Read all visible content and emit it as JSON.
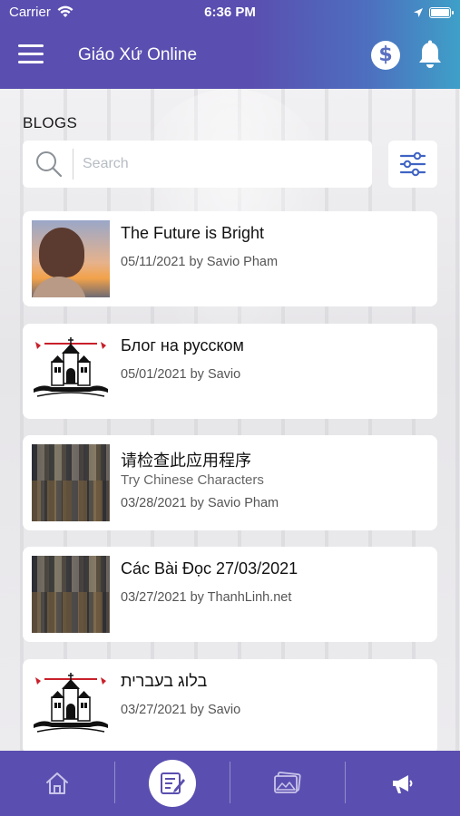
{
  "status_bar": {
    "carrier": "Carrier",
    "time": "6:36 PM"
  },
  "header": {
    "title": "Giáo Xứ Online"
  },
  "page": {
    "section_title": "BLOGS"
  },
  "search": {
    "placeholder": "Search"
  },
  "posts": [
    {
      "title": "The Future is Bright",
      "subtitle": "",
      "meta": "05/11/2021 by Savio Pham",
      "thumbnail": "sunset-portrait"
    },
    {
      "title": "Блог на русском",
      "subtitle": "",
      "meta": "05/01/2021 by Savio",
      "thumbnail": "church-logo"
    },
    {
      "title": "请检查此应用程序",
      "subtitle": "Try Chinese Characters",
      "meta": "03/28/2021 by Savio Pham",
      "thumbnail": "crowd-photo"
    },
    {
      "title": "Các Bài Đọc 27/03/2021",
      "subtitle": "",
      "meta": "03/27/2021 by ThanhLinh.net",
      "thumbnail": "crowd-photo"
    },
    {
      "title": "בלוג בעברית",
      "subtitle": "",
      "meta": "03/27/2021 by Savio",
      "thumbnail": "church-logo"
    }
  ],
  "tabbar": {
    "items": [
      {
        "icon": "home-icon",
        "active": false
      },
      {
        "icon": "blog-edit-icon",
        "active": true
      },
      {
        "icon": "gallery-icon",
        "active": false
      },
      {
        "icon": "megaphone-icon",
        "active": false
      }
    ]
  },
  "colors": {
    "primary": "#5a4fb0",
    "accent": "#3ea0c8",
    "icon_blue": "#3f63c4"
  }
}
